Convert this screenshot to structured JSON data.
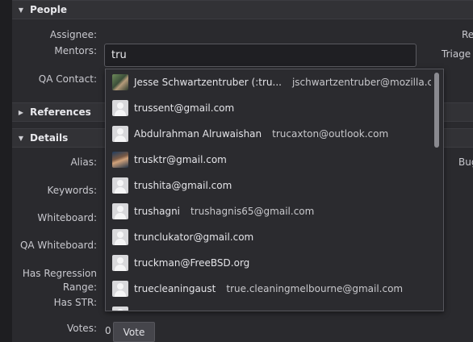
{
  "sections": {
    "people": "People",
    "references": "References",
    "details": "Details"
  },
  "people": {
    "assignee_label": "Assignee:",
    "mentors_label": "Mentors:",
    "mentors_value": "tru",
    "qa_contact_label": "QA Contact:",
    "right_labels": [
      "Re",
      "Triage"
    ]
  },
  "details": {
    "alias_label": "Alias:",
    "keywords_label": "Keywords:",
    "whiteboard_label": "Whiteboard:",
    "qa_whiteboard_label": "QA Whiteboard:",
    "has_regression_range_label": "Has Regression Range:",
    "has_str_label": "Has STR:",
    "votes_label": "Votes:",
    "votes_count": "0",
    "vote_button": "Vote",
    "right_label": "Bug"
  },
  "suggestions": [
    {
      "name": "Jesse Schwartzentruber (:tru...",
      "email": "jschwartzentruber@mozilla.com",
      "avatar": "photo"
    },
    {
      "name": "trussent@gmail.com",
      "email": "",
      "avatar": "default"
    },
    {
      "name": "Abdulrahman Alruwaishan",
      "email": "trucaxton@outlook.com",
      "avatar": "default"
    },
    {
      "name": "trusktr@gmail.com",
      "email": "",
      "avatar": "photo"
    },
    {
      "name": "trushita@gmail.com",
      "email": "",
      "avatar": "default"
    },
    {
      "name": "trushagni",
      "email": "trushagnis65@gmail.com",
      "avatar": "default"
    },
    {
      "name": "trunclukator@gmail.com",
      "email": "",
      "avatar": "default"
    },
    {
      "name": "truckman@FreeBSD.org",
      "email": "",
      "avatar": "default"
    },
    {
      "name": "truecleaningaust",
      "email": "true.cleaningmelbourne@gmail.com",
      "avatar": "default"
    }
  ]
}
